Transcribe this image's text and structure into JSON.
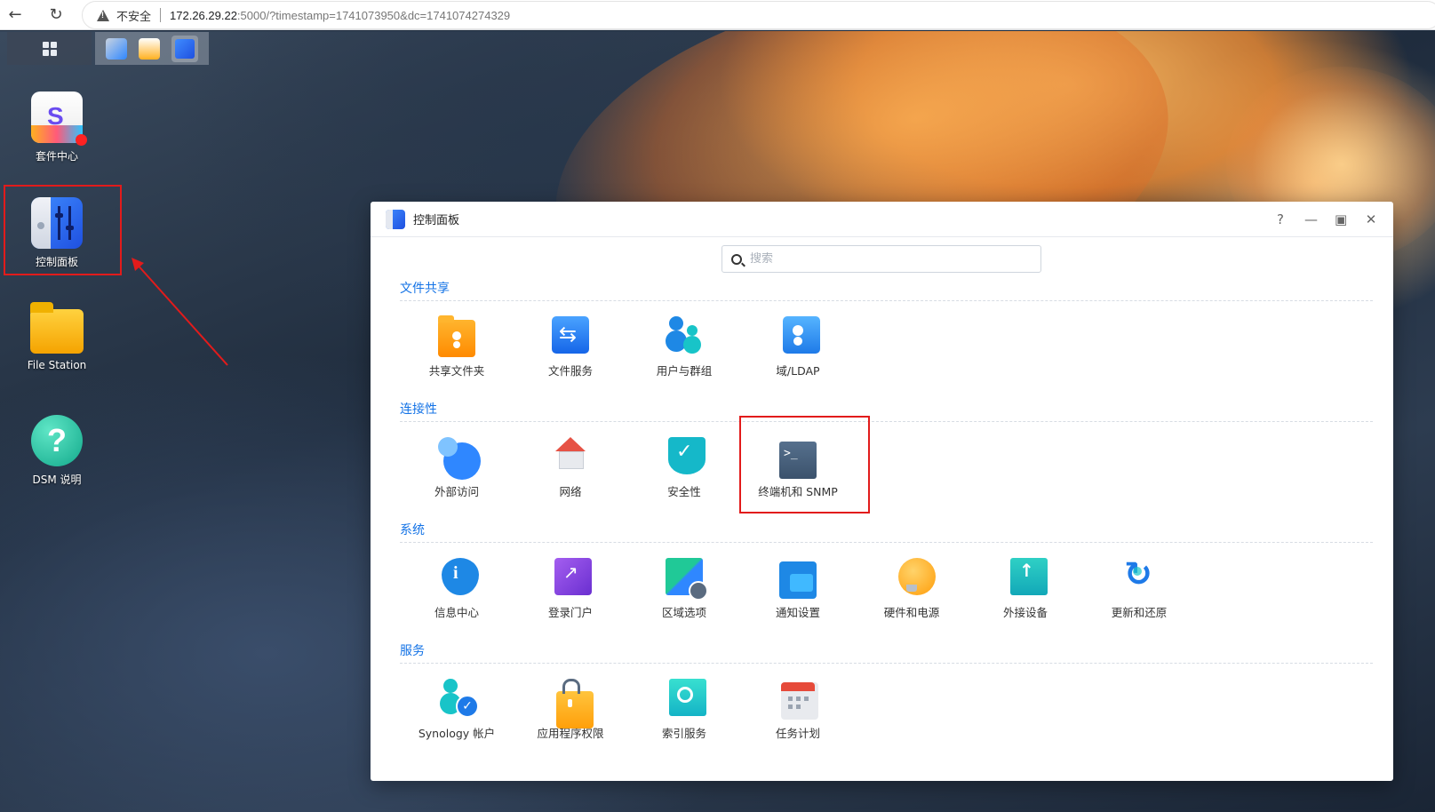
{
  "browser": {
    "security_label": "不安全",
    "url_host": "172.26.29.22",
    "url_rest": ":5000/?timestamp=1741073950&dc=1741074274329"
  },
  "desktop_icons": [
    {
      "label": "套件中心"
    },
    {
      "label": "控制面板"
    },
    {
      "label": "File Station"
    },
    {
      "label": "DSM 说明"
    }
  ],
  "window": {
    "title": "控制面板",
    "search_placeholder": "搜索",
    "sections": [
      {
        "title": "文件共享",
        "items": [
          "共享文件夹",
          "文件服务",
          "用户与群组",
          "域/LDAP"
        ]
      },
      {
        "title": "连接性",
        "items": [
          "外部访问",
          "网络",
          "安全性",
          "终端机和 SNMP"
        ]
      },
      {
        "title": "系统",
        "items": [
          "信息中心",
          "登录门户",
          "区域选项",
          "通知设置",
          "硬件和电源",
          "外接设备",
          "更新和还原"
        ]
      },
      {
        "title": "服务",
        "items": [
          "Synology 帐户",
          "应用程序权限",
          "索引服务",
          "任务计划"
        ]
      }
    ]
  },
  "colors": {
    "accent": "#1473e6",
    "highlight": "#e21b1b"
  }
}
